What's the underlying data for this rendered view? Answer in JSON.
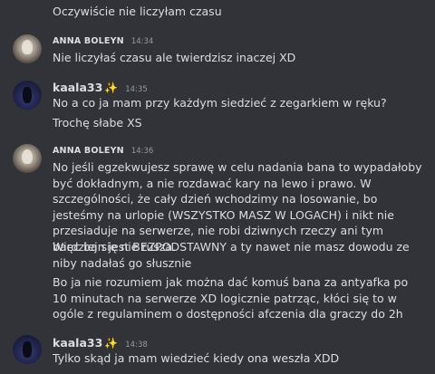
{
  "messages": {
    "m0": {
      "text": "Oczywiście nie liczyłam czasu"
    },
    "m1": {
      "author": "ANNA BOLEYN",
      "time": "14:34",
      "text": "Nie liczyłaś czasu ale twierdzisz inaczej XD"
    },
    "m2": {
      "author": "kaala33",
      "badge": "✨",
      "time": "14:35",
      "lines": [
        "No a co ja mam przy każdym siedzieć z zegarkiem w ręku?",
        "Trochę słabe XS"
      ]
    },
    "m3": {
      "author": "ANNA BOLEYN",
      "time": "14:36",
      "paragraphs": [
        "No jeśli egzekwujesz sprawę w celu nadania bana to wypadałoby być dokładnym, a nie rozdawać kary na lewo i prawo. W szczególności, że cały dzień wchodzimy na losowanie, bo jesteśmy na urlopie (WSZYSTKO MASZ W LOGACH) i nikt nie przesiaduje na serwerze, nie robi dziwnych rzeczy ani tym bardziej się nie rusza.",
        "Więc ban jest BEZPODSTAWNY a ty nawet nie masz dowodu ze niby nadałaś go słusznie",
        "Bo ja nie rozumiem jak można dać komuś bana za antyafka po 10  minutach na serwerze XD logicznie patrząc, kłóci się to w ogóle z regulaminem o dostępności afczenia dla graczy do 2h"
      ]
    },
    "m4": {
      "author": "kaala33",
      "badge": "✨",
      "time": "14:38",
      "text": "Tylko skąd ja mam wiedzieć kiedy ona weszła XDD"
    }
  }
}
